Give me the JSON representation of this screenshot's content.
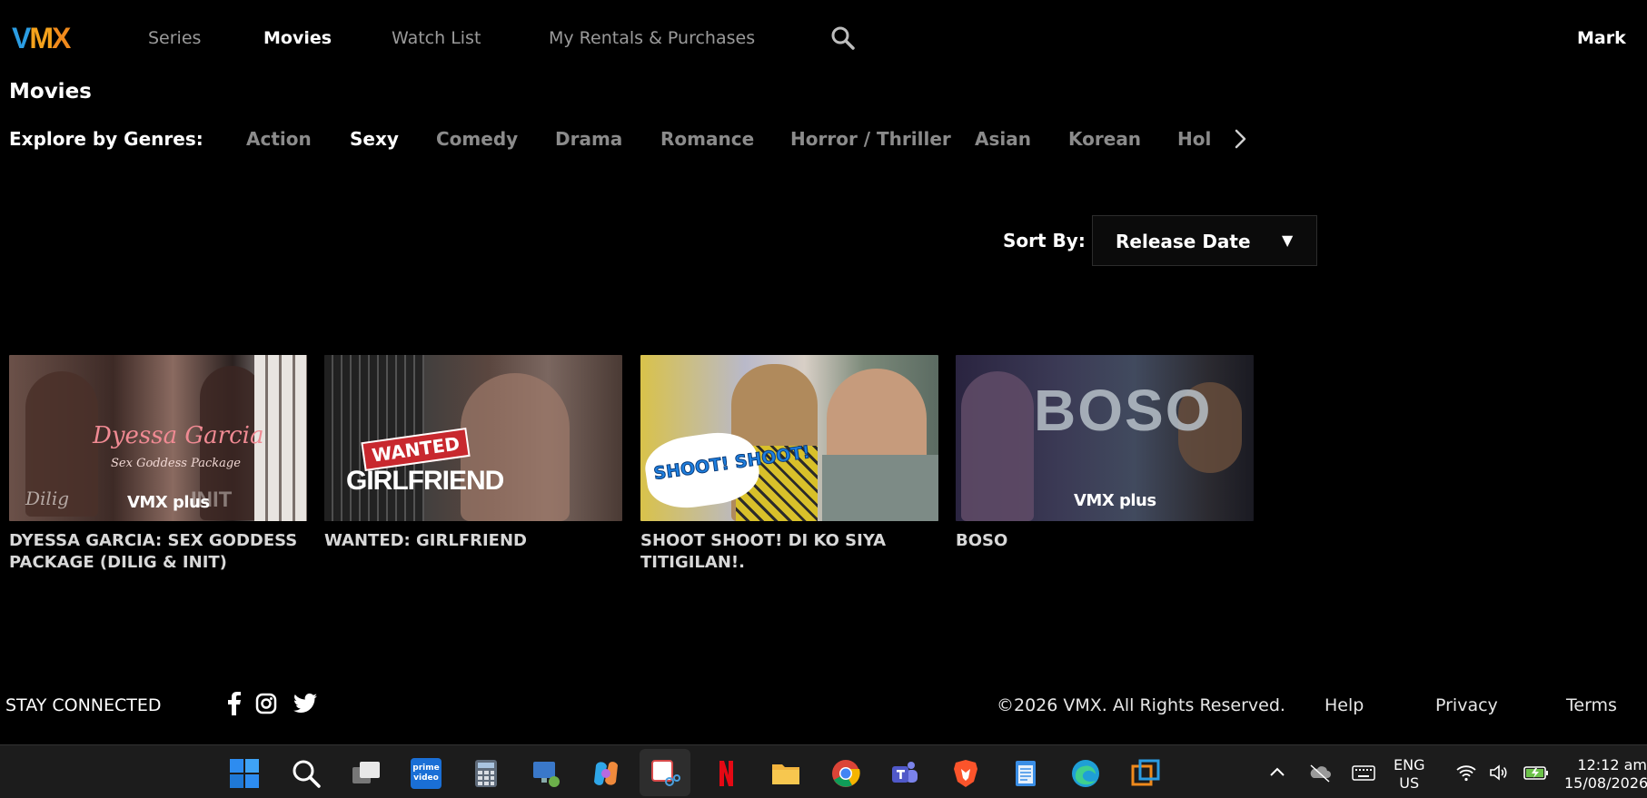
{
  "app": {
    "logo": {
      "v": "V",
      "m": "M",
      "x": "X"
    },
    "nav": [
      "Series",
      "Movies",
      "Watch List",
      "My Rentals & Purchases"
    ],
    "user": "Mark"
  },
  "page": {
    "title": "Movies",
    "genres_label": "Explore by Genres:",
    "genres": [
      "Action",
      "Sexy",
      "Comedy",
      "Drama",
      "Romance",
      "Horror / Thriller",
      "Asian",
      "Korean",
      "Hol"
    ],
    "active_genre": "Sexy",
    "sort_label": "Sort By:",
    "sort_value": "Release Date"
  },
  "movies": [
    {
      "title": "DYESSA GARCIA: SEX GODDESS PACKAGE (DILIG & INIT)",
      "thumb_script": "Dyessa Garcia",
      "thumb_sub": "Sex Goddess Package",
      "thumb_extra_left": "Dilig",
      "thumb_extra_right": "INIT",
      "brand": "VMX plus"
    },
    {
      "title": "WANTED: GIRLFRIEND",
      "thumb_badge": "WANTED",
      "thumb_main": "GIRLFRIEND"
    },
    {
      "title": "SHOOT SHOOT! DI KO SIYA TITIGILAN!.",
      "thumb_badge": "SHOOT! SHOOT!"
    },
    {
      "title": "BOSO",
      "thumb_main": "BOSO",
      "brand": "VMX plus"
    }
  ],
  "footer": {
    "stay_connected": "STAY CONNECTED",
    "copyright": "©2026 VMX. All Rights Reserved.",
    "links": [
      "Help",
      "Privacy",
      "Terms"
    ]
  },
  "taskbar": {
    "icons": [
      "windows-start",
      "search",
      "task-view",
      "prime-video",
      "calculator",
      "remote-desktop",
      "copilot",
      "snipping-tool",
      "netflix",
      "file-explorer",
      "chrome",
      "teams",
      "brave",
      "notepad",
      "edge",
      "app"
    ],
    "prime_label": "prime video",
    "lang_top": "ENG",
    "lang_bottom": "US",
    "time": "12:12 am",
    "date": "15/08/2026"
  },
  "colors": {
    "background": "#000000",
    "logo_blue": "#2b9de3",
    "logo_orange": "#f5a21c",
    "inactive_text": "#8b8b8b"
  }
}
